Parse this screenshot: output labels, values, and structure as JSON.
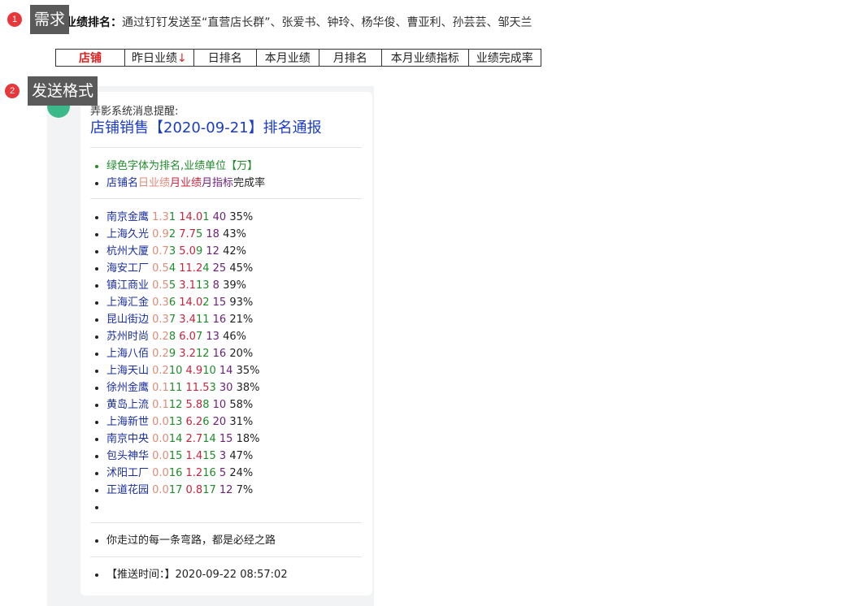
{
  "annotations": [
    {
      "num": "1",
      "label": "需求"
    },
    {
      "num": "2",
      "label": "发送格式"
    }
  ],
  "requirement": {
    "prefix": "业绩排名：",
    "text": "通过钉钉发送至“直营店长群”、张爱书、钟玲、杨华俊、曹亚利、孙芸芸、邹天兰"
  },
  "header_columns": [
    {
      "label": "店铺"
    },
    {
      "label": "昨日业绩",
      "arrow": "↓"
    },
    {
      "label": "日排名"
    },
    {
      "label": "本月业绩"
    },
    {
      "label": "月排名"
    },
    {
      "label": "本月业绩指标"
    },
    {
      "label": "业绩完成率"
    }
  ],
  "message": {
    "sender": "弄影系统消息提醒:",
    "title": "店铺销售【2020-09-21】排名通报",
    "legend_note": "绿色字体为排名,业绩单位【万】",
    "legend_fields": [
      "店铺名",
      "日业绩",
      "月业绩",
      "月指标",
      "完成率"
    ],
    "rows": [
      [
        "南京金鹰",
        "1.3",
        "1",
        "14.0",
        "1",
        "40",
        "35%"
      ],
      [
        "上海久光",
        "0.9",
        "2",
        "7.7",
        "5",
        "18",
        "43%"
      ],
      [
        "杭州大厦",
        "0.7",
        "3",
        "5.0",
        "9",
        "12",
        "42%"
      ],
      [
        "海安工厂",
        "0.5",
        "4",
        "11.2",
        "4",
        "25",
        "45%"
      ],
      [
        "镇江商业",
        "0.5",
        "5",
        "3.1",
        "13",
        "8",
        "39%"
      ],
      [
        "上海汇金",
        "0.3",
        "6",
        "14.0",
        "2",
        "15",
        "93%"
      ],
      [
        "昆山街边",
        "0.3",
        "7",
        "3.4",
        "11",
        "16",
        "21%"
      ],
      [
        "苏州时尚",
        "0.2",
        "8",
        "6.0",
        "7",
        "13",
        "46%"
      ],
      [
        "上海八佰",
        "0.2",
        "9",
        "3.2",
        "12",
        "16",
        "20%"
      ],
      [
        "上海天山",
        "0.2",
        "10",
        "4.9",
        "10",
        "14",
        "35%"
      ],
      [
        "徐州金鹰",
        "0.1",
        "11",
        "11.5",
        "3",
        "30",
        "38%"
      ],
      [
        "黄岛上流",
        "0.1",
        "12",
        "5.8",
        "8",
        "10",
        "58%"
      ],
      [
        "上海新世",
        "0.0",
        "13",
        "6.2",
        "6",
        "20",
        "31%"
      ],
      [
        "南京中央",
        "0.0",
        "14",
        "2.7",
        "14",
        "15",
        "18%"
      ],
      [
        "包头神华",
        "0.0",
        "15",
        "1.4",
        "15",
        "3",
        "47%"
      ],
      [
        "沭阳工厂",
        "0.0",
        "16",
        "1.2",
        "16",
        "5",
        "24%"
      ],
      [
        "正道花园",
        "0.0",
        "17",
        "0.8",
        "17",
        "12",
        "7%"
      ]
    ],
    "motto": "你走过的每一条弯路，都是必经之路",
    "push_label": "【推送时间：】",
    "push_time": "2020-09-22 08:57:02"
  }
}
